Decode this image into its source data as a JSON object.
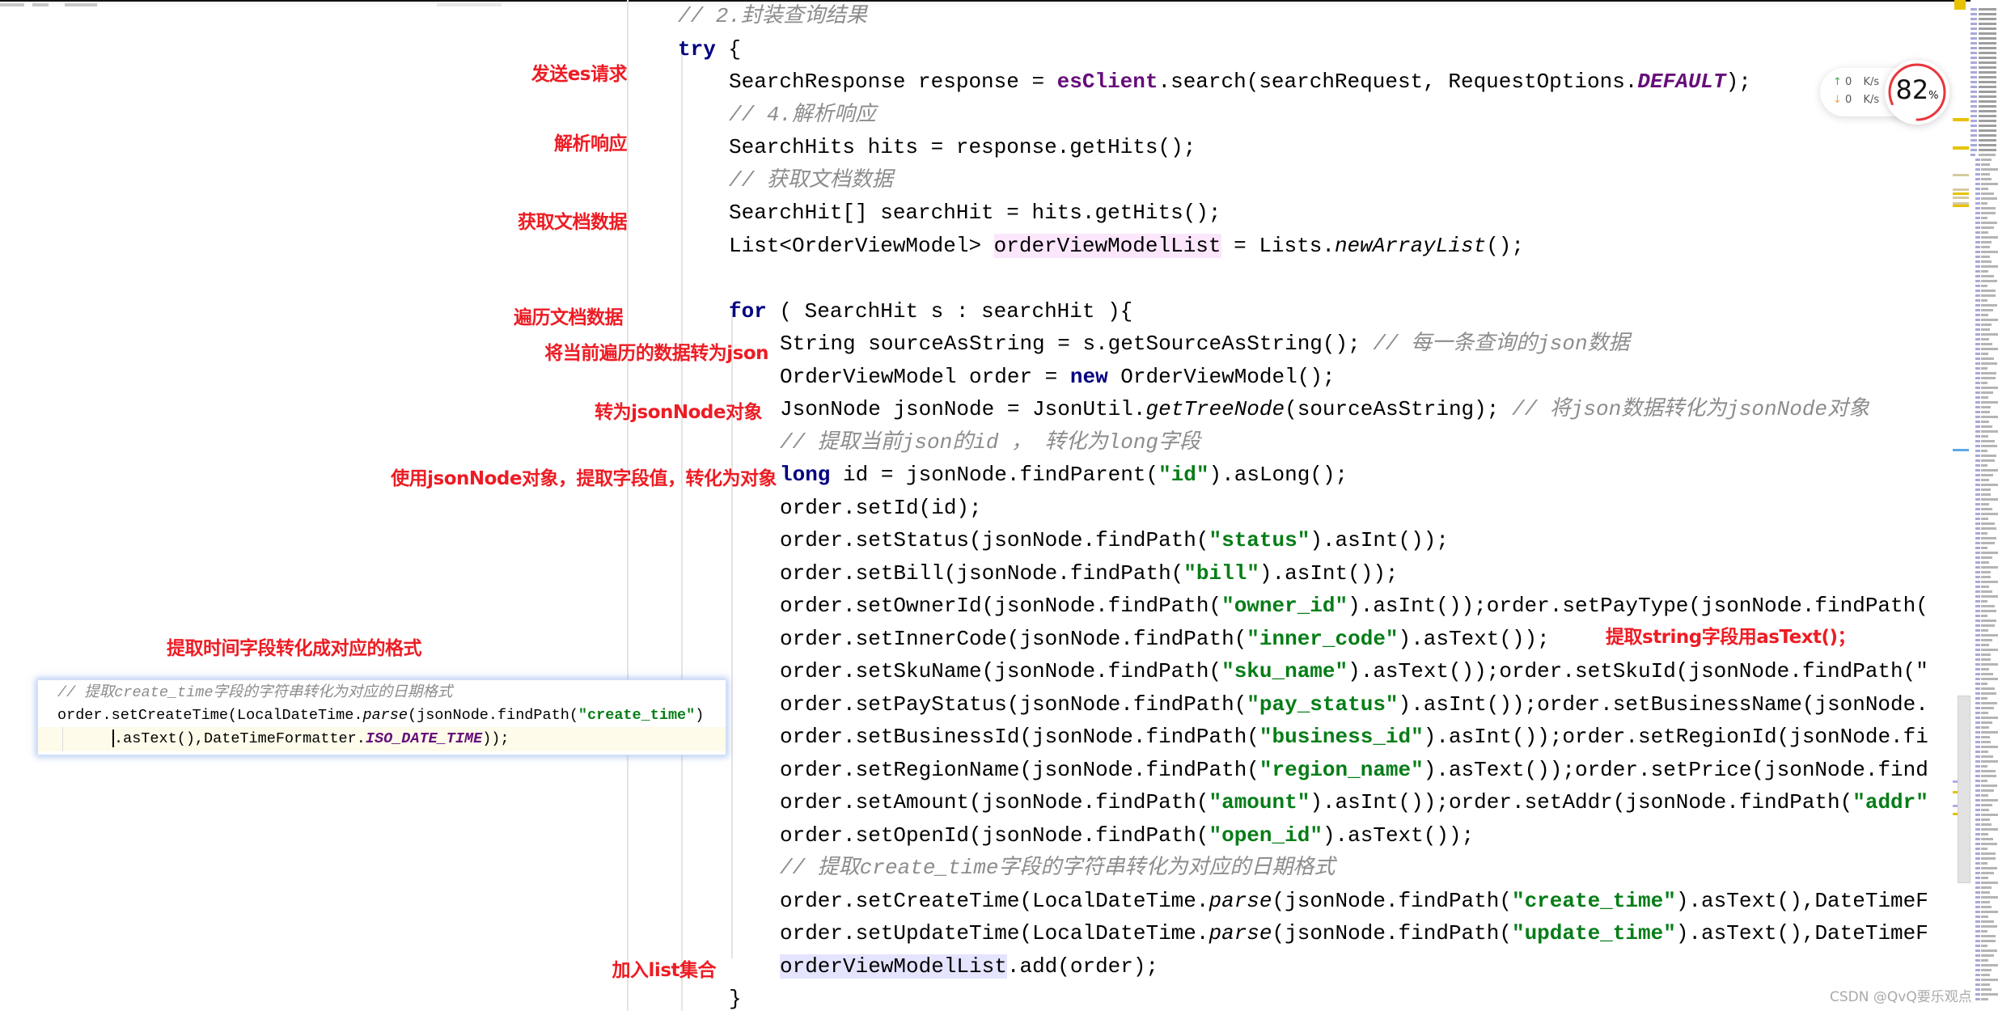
{
  "editor": {
    "lines": [
      {
        "indent": 0,
        "parts": [
          {
            "t": "// 2.封装查询结果",
            "c": "cm"
          }
        ]
      },
      {
        "indent": 0,
        "parts": [
          {
            "t": "try",
            "c": "kw"
          },
          {
            "t": " {",
            "c": ""
          }
        ]
      },
      {
        "indent": 1,
        "parts": [
          {
            "t": "SearchResponse response = ",
            "c": ""
          },
          {
            "t": "esClient",
            "c": "fld"
          },
          {
            "t": ".search(searchRequest, RequestOptions.",
            "c": ""
          },
          {
            "t": "DEFAULT",
            "c": "fldi"
          },
          {
            "t": ");",
            "c": ""
          }
        ]
      },
      {
        "indent": 1,
        "parts": [
          {
            "t": "// 4.解析响应",
            "c": "cm"
          }
        ]
      },
      {
        "indent": 1,
        "parts": [
          {
            "t": "SearchHits hits = response.getHits();",
            "c": ""
          }
        ]
      },
      {
        "indent": 1,
        "parts": [
          {
            "t": "// 获取文档数据",
            "c": "cm"
          }
        ]
      },
      {
        "indent": 1,
        "parts": [
          {
            "t": "SearchHit[] searchHit = hits.getHits();",
            "c": ""
          }
        ]
      },
      {
        "indent": 1,
        "parts": [
          {
            "t": "List<OrderViewModel> ",
            "c": ""
          },
          {
            "t": "orderViewModelList",
            "c": "hl-pink"
          },
          {
            "t": " = Lists.",
            "c": ""
          },
          {
            "t": "newArrayList",
            "c": "it"
          },
          {
            "t": "();",
            "c": ""
          }
        ]
      },
      {
        "indent": 1,
        "parts": [
          {
            "t": "",
            "c": ""
          }
        ]
      },
      {
        "indent": 1,
        "parts": [
          {
            "t": "for",
            "c": "kw"
          },
          {
            "t": " ( SearchHit s : searchHit ){",
            "c": ""
          }
        ]
      },
      {
        "indent": 2,
        "parts": [
          {
            "t": "String sourceAsString = s.getSourceAsString(); ",
            "c": ""
          },
          {
            "t": "// 每一条查询的json数据",
            "c": "cm"
          }
        ]
      },
      {
        "indent": 2,
        "parts": [
          {
            "t": "OrderViewModel order = ",
            "c": ""
          },
          {
            "t": "new",
            "c": "kw"
          },
          {
            "t": " OrderViewModel();",
            "c": ""
          }
        ]
      },
      {
        "indent": 2,
        "parts": [
          {
            "t": "JsonNode jsonNode = JsonUtil.",
            "c": ""
          },
          {
            "t": "getTreeNode",
            "c": "it"
          },
          {
            "t": "(sourceAsString); ",
            "c": ""
          },
          {
            "t": "// 将json数据转化为jsonNode对象",
            "c": "cm"
          }
        ]
      },
      {
        "indent": 2,
        "parts": [
          {
            "t": "// 提取当前json的id ， 转化为long字段",
            "c": "cm"
          }
        ]
      },
      {
        "indent": 2,
        "parts": [
          {
            "t": "long",
            "c": "kw"
          },
          {
            "t": " id = jsonNode.findParent(",
            "c": ""
          },
          {
            "t": "\"id\"",
            "c": "str"
          },
          {
            "t": ").asLong();",
            "c": ""
          }
        ]
      },
      {
        "indent": 2,
        "parts": [
          {
            "t": "order.setId(id);",
            "c": ""
          }
        ]
      },
      {
        "indent": 2,
        "parts": [
          {
            "t": "order.setStatus(jsonNode.findPath(",
            "c": ""
          },
          {
            "t": "\"status\"",
            "c": "str"
          },
          {
            "t": ").asInt());",
            "c": ""
          }
        ]
      },
      {
        "indent": 2,
        "parts": [
          {
            "t": "order.setBill(jsonNode.findPath(",
            "c": ""
          },
          {
            "t": "\"bill\"",
            "c": "str"
          },
          {
            "t": ").asInt());",
            "c": ""
          }
        ]
      },
      {
        "indent": 2,
        "parts": [
          {
            "t": "order.setOwnerId(jsonNode.findPath(",
            "c": ""
          },
          {
            "t": "\"owner_id\"",
            "c": "str"
          },
          {
            "t": ").asInt());order.setPayType(jsonNode.findPath(",
            "c": ""
          }
        ]
      },
      {
        "indent": 2,
        "parts": [
          {
            "t": "order.setInnerCode(jsonNode.findPath(",
            "c": ""
          },
          {
            "t": "\"inner_code\"",
            "c": "str"
          },
          {
            "t": ").asText());",
            "c": ""
          }
        ]
      },
      {
        "indent": 2,
        "parts": [
          {
            "t": "order.setSkuName(jsonNode.findPath(",
            "c": ""
          },
          {
            "t": "\"sku_name\"",
            "c": "str"
          },
          {
            "t": ").asText());order.setSkuId(jsonNode.findPath(\"",
            "c": ""
          }
        ]
      },
      {
        "indent": 2,
        "parts": [
          {
            "t": "order.setPayStatus(jsonNode.findPath(",
            "c": ""
          },
          {
            "t": "\"pay_status\"",
            "c": "str"
          },
          {
            "t": ").asInt());order.setBusinessName(jsonNode.",
            "c": ""
          }
        ]
      },
      {
        "indent": 2,
        "parts": [
          {
            "t": "order.setBusinessId(jsonNode.findPath(",
            "c": ""
          },
          {
            "t": "\"business_id\"",
            "c": "str"
          },
          {
            "t": ").asInt());order.setRegionId(jsonNode.fi",
            "c": ""
          }
        ]
      },
      {
        "indent": 2,
        "parts": [
          {
            "t": "order.setRegionName(jsonNode.findPath(",
            "c": ""
          },
          {
            "t": "\"region_name\"",
            "c": "str"
          },
          {
            "t": ").asText());order.setPrice(jsonNode.find",
            "c": ""
          }
        ]
      },
      {
        "indent": 2,
        "parts": [
          {
            "t": "order.setAmount(jsonNode.findPath(",
            "c": ""
          },
          {
            "t": "\"amount\"",
            "c": "str"
          },
          {
            "t": ").asInt());order.setAddr(jsonNode.findPath(",
            "c": ""
          },
          {
            "t": "\"addr\"",
            "c": "str"
          }
        ]
      },
      {
        "indent": 2,
        "parts": [
          {
            "t": "order.setOpenId(jsonNode.findPath(",
            "c": ""
          },
          {
            "t": "\"open_id\"",
            "c": "str"
          },
          {
            "t": ").asText());",
            "c": ""
          }
        ]
      },
      {
        "indent": 2,
        "parts": [
          {
            "t": "// 提取create_time字段的字符串转化为对应的日期格式",
            "c": "cm"
          }
        ]
      },
      {
        "indent": 2,
        "parts": [
          {
            "t": "order.setCreateTime(LocalDateTime.",
            "c": ""
          },
          {
            "t": "parse",
            "c": "it"
          },
          {
            "t": "(jsonNode.findPath(",
            "c": ""
          },
          {
            "t": "\"create_time\"",
            "c": "str"
          },
          {
            "t": ").asText(),DateTimeF",
            "c": ""
          }
        ]
      },
      {
        "indent": 2,
        "parts": [
          {
            "t": "order.setUpdateTime(LocalDateTime.",
            "c": ""
          },
          {
            "t": "parse",
            "c": "it"
          },
          {
            "t": "(jsonNode.findPath(",
            "c": ""
          },
          {
            "t": "\"update_time\"",
            "c": "str"
          },
          {
            "t": ").asText(),DateTimeF",
            "c": ""
          }
        ]
      },
      {
        "indent": 2,
        "parts": [
          {
            "t": "orderViewModelList",
            "c": "hl-blue"
          },
          {
            "t": ".add(order);",
            "c": ""
          }
        ]
      },
      {
        "indent": 1,
        "parts": [
          {
            "t": "}",
            "c": ""
          }
        ]
      }
    ]
  },
  "annotations": [
    {
      "text": "发送es请求",
      "line": 2
    },
    {
      "text": "解析响应",
      "line": 4
    },
    {
      "text": "获取文档数据",
      "line": 6
    },
    {
      "text": "遍历文档数据",
      "line": 9
    },
    {
      "text": "将当前遍历的数据转为json",
      "line": 10
    },
    {
      "text": "转为jsonNode对象",
      "line": 12
    },
    {
      "text": "使用jsonNode对象，提取字段值，转化为对象",
      "line": 14
    },
    {
      "text": "提取string字段用asText()；",
      "line": 19
    },
    {
      "text": "提取时间字段转化成对应的格式",
      "line": 19
    },
    {
      "text": "加入list集合",
      "line": 29
    }
  ],
  "popup": {
    "comment": "// 提取create_time字段的字符串转化为对应的日期格式",
    "line1_a": "order.setCreateTime(LocalDateTime.",
    "line1_b": "parse",
    "line1_c": "(jsonNode.findPath(",
    "line1_d": "\"create_time\"",
    "line1_e": ")",
    "line2_a": ".asText(),DateTimeFormatter.",
    "line2_b": "ISO_DATE_TIME",
    "line2_c": "));"
  },
  "net_widget": {
    "upload": "0",
    "download": "0",
    "unit": "K/s",
    "up_icon": "arrow-up-icon",
    "down_icon": "arrow-down-icon"
  },
  "gauge": {
    "value": 82,
    "value_text": "82",
    "suffix": "%",
    "color": "#e8363d"
  },
  "watermark": "CSDN @QvQ要乐观点",
  "colors": {
    "keyword": "#000080",
    "string": "#067d17",
    "field": "#660e7a",
    "comment": "#8c8c8c",
    "annotation": "#ed1c24"
  }
}
